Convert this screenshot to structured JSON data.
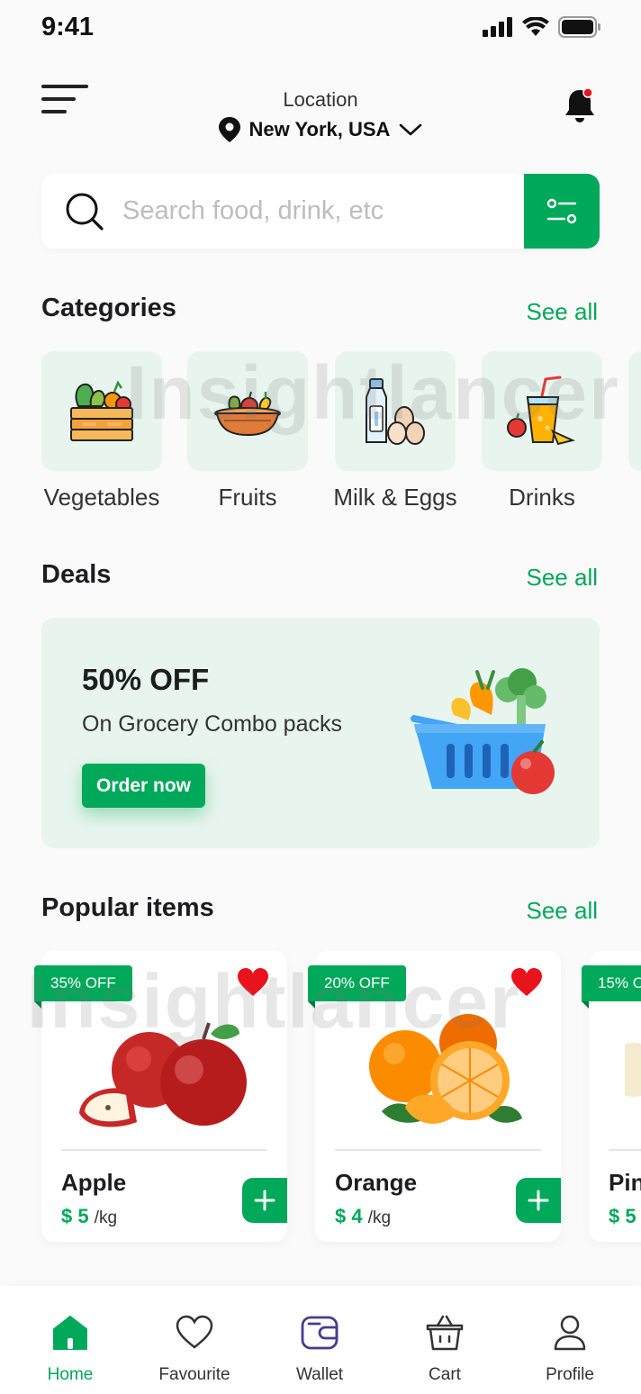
{
  "status": {
    "time": "9:41"
  },
  "header": {
    "location_label": "Location",
    "location_value": "New York, USA"
  },
  "search": {
    "placeholder": "Search food, drink, etc"
  },
  "categories": {
    "title": "Categories",
    "see_all": "See all",
    "items": [
      {
        "label": "Vegetables",
        "icon": "vegetable-crate-icon"
      },
      {
        "label": "Fruits",
        "icon": "fruit-basket-icon"
      },
      {
        "label": "Milk & Eggs",
        "icon": "milk-eggs-icon"
      },
      {
        "label": "Drinks",
        "icon": "juice-drink-icon"
      }
    ]
  },
  "deals": {
    "title": "Deals",
    "see_all": "See all",
    "card": {
      "headline": "50% OFF",
      "subtitle": "On Grocery Combo packs",
      "button": "Order now",
      "image": "grocery-basket-icon"
    }
  },
  "popular": {
    "title": "Popular items",
    "see_all": "See all",
    "items": [
      {
        "name": "Apple",
        "price": "$ 5",
        "unit": "/kg",
        "badge": "35% OFF",
        "image": "apple-icon"
      },
      {
        "name": "Orange",
        "price": "$ 4",
        "unit": "/kg",
        "badge": "20% OFF",
        "image": "orange-icon"
      },
      {
        "name": "Pin",
        "price": "$ 5",
        "unit": "",
        "badge": "15% O",
        "image": "fruit-icon"
      }
    ]
  },
  "nav": {
    "items": [
      {
        "label": "Home",
        "icon": "home-icon",
        "active": true
      },
      {
        "label": "Favourite",
        "icon": "heart-icon",
        "active": false
      },
      {
        "label": "Wallet",
        "icon": "wallet-icon",
        "active": false
      },
      {
        "label": "Cart",
        "icon": "basket-icon",
        "active": false
      },
      {
        "label": "Profile",
        "icon": "profile-icon",
        "active": false
      }
    ]
  },
  "watermark": {
    "text": "Insightlancer"
  },
  "colors": {
    "accent": "#00a85a",
    "tile_bg": "#e8f5ee",
    "heart": "#e8131c"
  }
}
